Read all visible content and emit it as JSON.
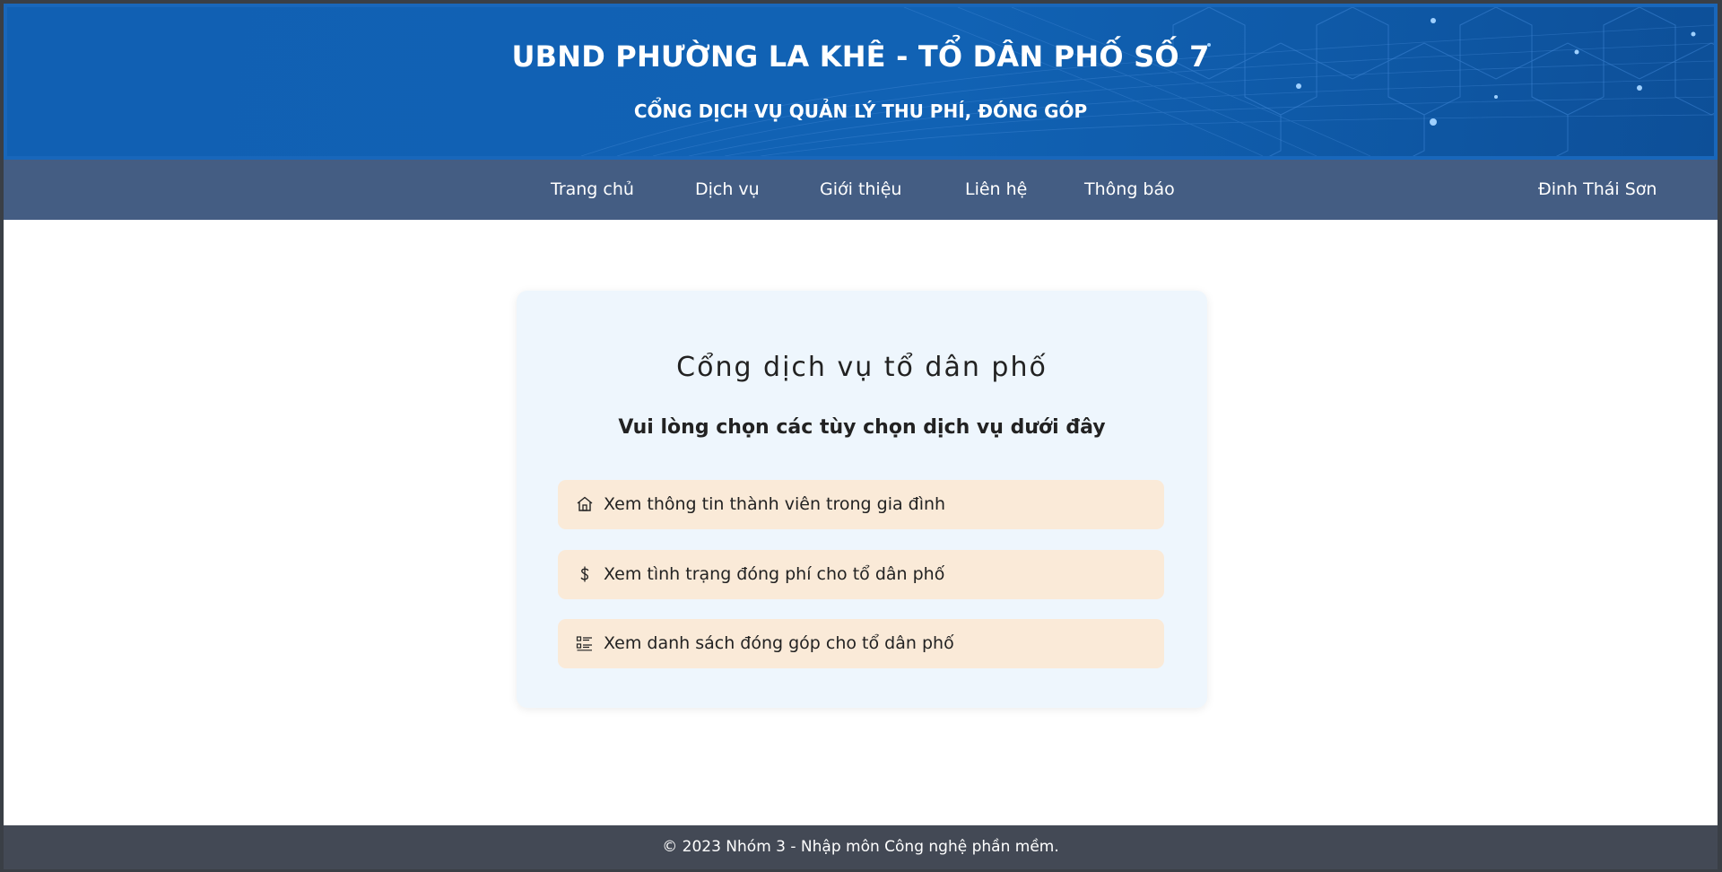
{
  "header": {
    "title": "UBND PHƯỜNG LA KHÊ - TỔ DÂN PHỐ SỐ 7",
    "subtitle": "CỔNG DỊCH VỤ QUẢN LÝ THU PHÍ, ĐÓNG GÓP"
  },
  "nav": {
    "items": [
      {
        "label": "Trang chủ"
      },
      {
        "label": "Dịch vụ"
      },
      {
        "label": "Giới thiệu"
      },
      {
        "label": "Liên hệ"
      },
      {
        "label": "Thông báo"
      }
    ],
    "user_name": "Đinh Thái Sơn"
  },
  "main": {
    "title": "Cổng dịch vụ tổ dân phố",
    "subtitle": "Vui lòng chọn các tùy chọn dịch vụ dưới đây",
    "options": [
      {
        "label": "Xem thông tin thành viên trong gia đình",
        "icon": "house-icon"
      },
      {
        "label": "Xem tình trạng đóng phí cho tổ dân phố",
        "icon": "dollar-icon"
      },
      {
        "label": "Xem danh sách đóng góp cho tổ dân phố",
        "icon": "list-icon"
      }
    ]
  },
  "footer": {
    "text": "© 2023 Nhóm 3 - Nhập môn Công nghệ phần mềm."
  },
  "colors": {
    "banner": "#1160b3",
    "navbar": "#445d83",
    "card": "#eef6fd",
    "option": "#faead8",
    "footer": "#434955"
  }
}
